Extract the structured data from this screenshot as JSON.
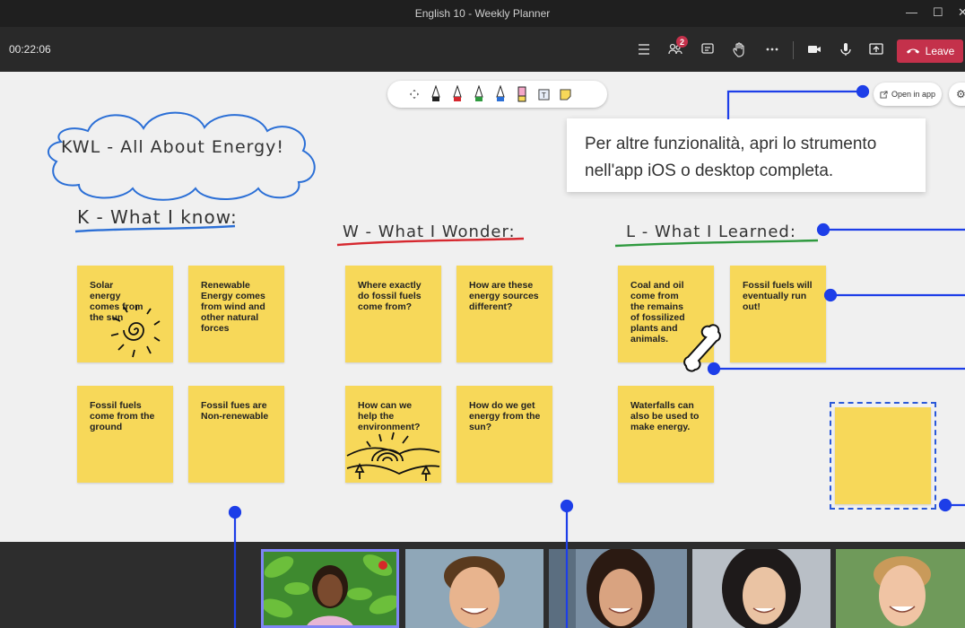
{
  "window": {
    "title": "English 10 - Weekly Planner"
  },
  "meeting": {
    "timer": "00:22:06",
    "people_badge": "2",
    "leave_label": "Leave"
  },
  "whiteboard": {
    "open_in_app_label": "Open in app",
    "tooltip_text": "Per altre funzionalità, apri lo strumento nell'app iOS o desktop completa.",
    "title": "KWL - All About Energy!",
    "columns": {
      "k": "K - What I know:",
      "w": "W - What I Wonder:",
      "l": "L - What I Learned:"
    },
    "notes": {
      "k1": "Solar energy comes from the sun",
      "k2": "Renewable Energy comes from wind and other natural forces",
      "k3": "Fossil fuels come from the ground",
      "k4": "Fossil fues are Non-renewable",
      "w1": "Where exactly do fossil fuels come from?",
      "w2": "How are these energy sources different?",
      "w3": "How can we help the environment?",
      "w4": "How do we get energy from the sun?",
      "l1": "Coal and oil come from the remains of fossilized plants and animals.",
      "l2": "Fossil fuels will eventually run out!",
      "l3": "Waterfalls can also be used to make energy.",
      "new": ""
    },
    "colors": {
      "note": "#f7d859",
      "underline_k": "#2b6fd6",
      "underline_w": "#d6282f",
      "underline_l": "#2f9a3f",
      "callout": "#1d3ee8"
    }
  },
  "participants": [
    {
      "name": "participant-1",
      "active": true
    },
    {
      "name": "participant-2",
      "active": false
    },
    {
      "name": "participant-3",
      "active": false
    },
    {
      "name": "participant-4",
      "active": false
    },
    {
      "name": "participant-5",
      "active": false
    }
  ]
}
